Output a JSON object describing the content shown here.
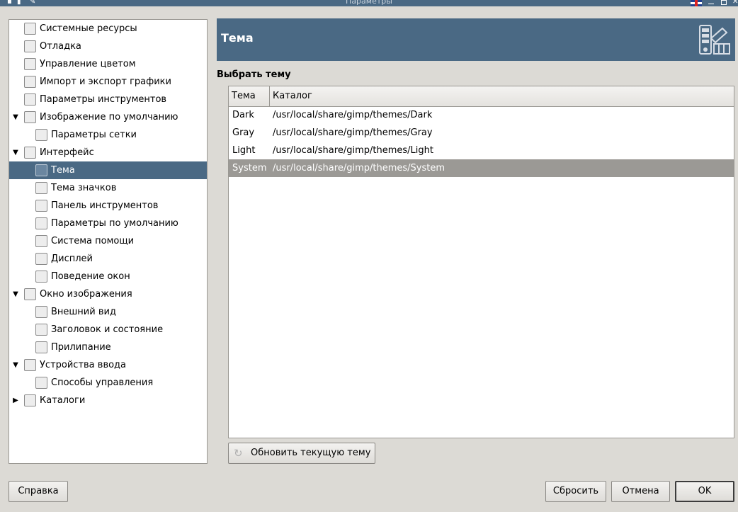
{
  "window": {
    "title": "Параметры"
  },
  "tree": {
    "items": [
      {
        "label": "Системные ресурсы",
        "icon": "chip-icon"
      },
      {
        "label": "Отладка",
        "icon": "debug-icon"
      },
      {
        "label": "Управление цветом",
        "icon": "color-management-icon"
      },
      {
        "label": "Импорт и экспорт графики",
        "icon": "import-export-icon"
      },
      {
        "label": "Параметры инструментов",
        "icon": "tool-options-icon"
      },
      {
        "label": "Изображение по умолчанию",
        "icon": "default-image-icon"
      },
      {
        "label": "Параметры сетки",
        "icon": "grid-icon"
      },
      {
        "label": "Интерфейс",
        "icon": "interface-icon"
      },
      {
        "label": "Тема",
        "icon": "theme-icon"
      },
      {
        "label": "Тема значков",
        "icon": "icon-theme-icon"
      },
      {
        "label": "Панель инструментов",
        "icon": "toolbox-icon"
      },
      {
        "label": "Параметры по умолчанию",
        "icon": "defaults-icon"
      },
      {
        "label": "Система помощи",
        "icon": "help-system-icon"
      },
      {
        "label": "Дисплей",
        "icon": "display-icon"
      },
      {
        "label": "Поведение окон",
        "icon": "window-management-icon"
      },
      {
        "label": "Окно изображения",
        "icon": "image-window-icon"
      },
      {
        "label": "Внешний вид",
        "icon": "appearance-icon"
      },
      {
        "label": "Заголовок и состояние",
        "icon": "title-status-icon"
      },
      {
        "label": "Прилипание",
        "icon": "snapping-icon"
      },
      {
        "label": "Устройства ввода",
        "icon": "input-devices-icon"
      },
      {
        "label": "Способы управления",
        "icon": "input-controllers-icon"
      },
      {
        "label": "Каталоги",
        "icon": "folders-icon"
      }
    ]
  },
  "header": {
    "title": "Тема",
    "icon": "theme-icon"
  },
  "section": {
    "title": "Выбрать тему"
  },
  "themes": {
    "columns": [
      "Тема",
      "Каталог"
    ],
    "rows": [
      {
        "name": "Dark",
        "dir": "/usr/local/share/gimp/themes/Dark"
      },
      {
        "name": "Gray",
        "dir": "/usr/local/share/gimp/themes/Gray"
      },
      {
        "name": "Light",
        "dir": "/usr/local/share/gimp/themes/Light"
      },
      {
        "name": "System",
        "dir": "/usr/local/share/gimp/themes/System"
      }
    ],
    "selected": "System"
  },
  "buttons": {
    "refresh": "Обновить текущую тему",
    "help": "Справка",
    "reset": "Сбросить",
    "cancel": "Отмена",
    "ok": "OK"
  },
  "colors": {
    "accent": "#4a6984",
    "selected_row": "#9b9995",
    "background": "#dcdad5"
  }
}
